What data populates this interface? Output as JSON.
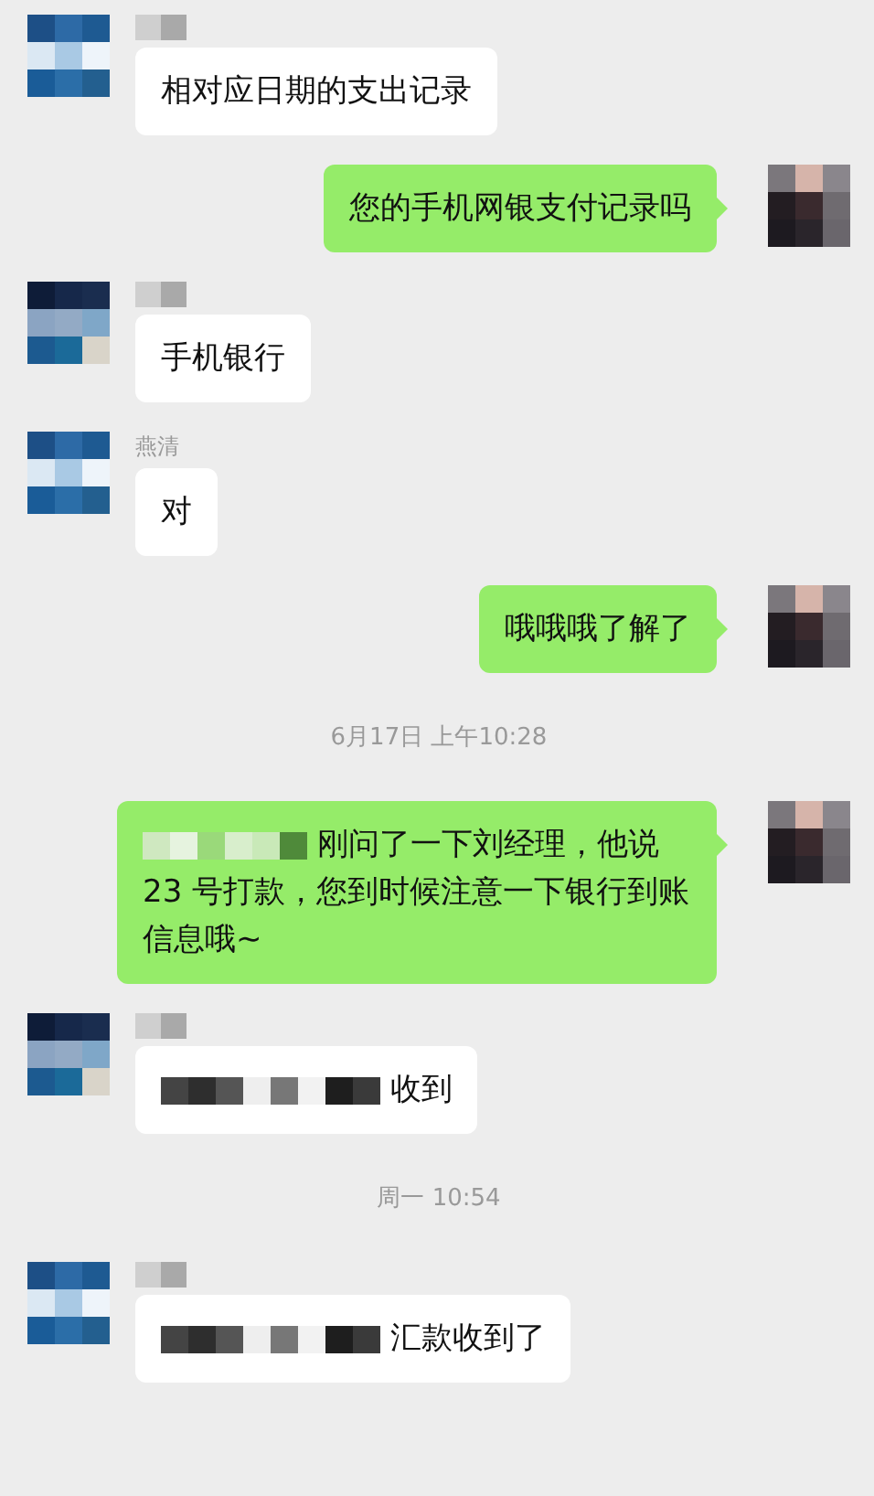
{
  "messages": [
    {
      "kind": "received",
      "sender": {
        "kind": "redacted"
      },
      "parts": [
        {
          "kind": "text",
          "text": "相对应日期的支出记录"
        }
      ]
    },
    {
      "kind": "sent",
      "parts": [
        {
          "kind": "text",
          "text": "您的手机网银支付记录吗"
        }
      ]
    },
    {
      "kind": "received",
      "sender": {
        "kind": "redacted"
      },
      "parts": [
        {
          "kind": "text",
          "text": "手机银行"
        }
      ]
    },
    {
      "kind": "received",
      "sender": {
        "kind": "name",
        "text": "燕清"
      },
      "parts": [
        {
          "kind": "text",
          "text": "对"
        }
      ]
    },
    {
      "kind": "sent",
      "parts": [
        {
          "kind": "text",
          "text": "哦哦哦了解了"
        }
      ]
    },
    {
      "kind": "time",
      "text": "6月17日 上午10:28"
    },
    {
      "kind": "sent",
      "parts": [
        {
          "kind": "redacted"
        },
        {
          "kind": "text",
          "text": "刚问了一下刘经理，他说23 号打款，您到时候注意一下银行到账信息哦~"
        }
      ]
    },
    {
      "kind": "received",
      "sender": {
        "kind": "redacted"
      },
      "parts": [
        {
          "kind": "redacted"
        },
        {
          "kind": "text",
          "text": "收到"
        }
      ]
    },
    {
      "kind": "time",
      "text": "周一 10:54"
    },
    {
      "kind": "received",
      "sender": {
        "kind": "redacted"
      },
      "parts": [
        {
          "kind": "redacted"
        },
        {
          "kind": "text",
          "text": "汇款收到了"
        }
      ]
    }
  ]
}
